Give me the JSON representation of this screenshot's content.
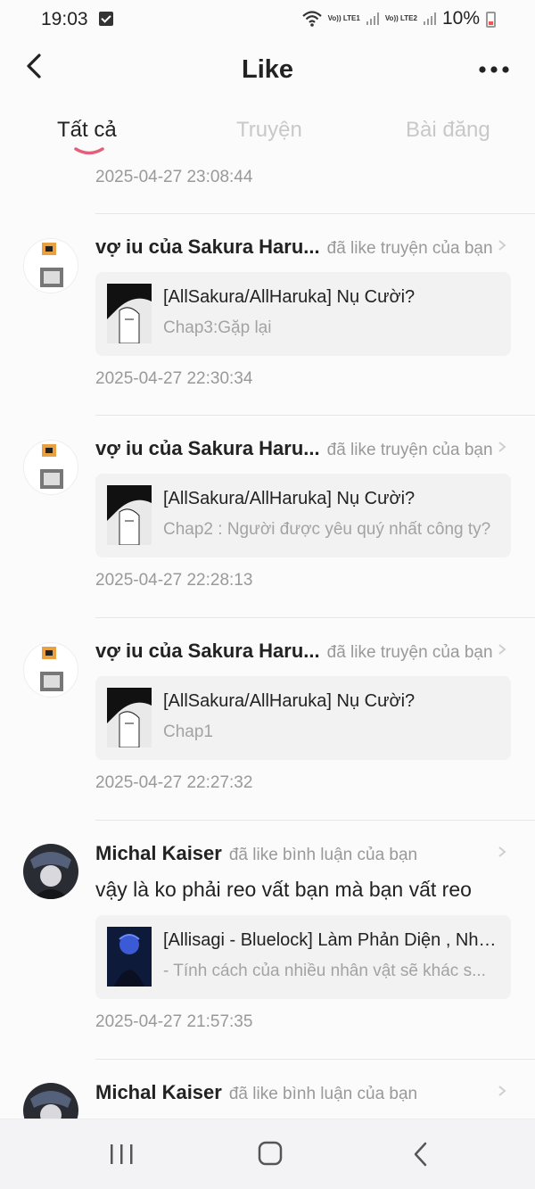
{
  "status": {
    "time": "19:03",
    "sim1": "Vo)) LTE1",
    "sim2": "Vo)) LTE2",
    "battery": "10%"
  },
  "header": {
    "title": "Like",
    "back_icon": "back-arrow-icon",
    "more_icon": "more-dots-icon"
  },
  "tabs": [
    {
      "label": "Tất cả",
      "active": true
    },
    {
      "label": "Truyện",
      "active": false
    },
    {
      "label": "Bài đăng",
      "active": false
    }
  ],
  "feed": {
    "top_timestamp": "2025-04-27 23:08:44",
    "items": [
      {
        "user": "vợ iu của Sakura Haru...",
        "action": "đã like truyện của bạn",
        "card_title": "[AllSakura/AllHaruka] Nụ Cười?",
        "card_sub": "Chap3:Gặp lại",
        "timestamp": "2025-04-27 22:30:34"
      },
      {
        "user": "vợ iu của Sakura Haru...",
        "action": "đã like truyện của bạn",
        "card_title": "[AllSakura/AllHaruka] Nụ Cười?",
        "card_sub": "Chap2 : Người được yêu quý nhất công ty?",
        "timestamp": "2025-04-27 22:28:13"
      },
      {
        "user": "vợ iu của Sakura Haru...",
        "action": "đã like truyện của bạn",
        "card_title": "[AllSakura/AllHaruka] Nụ Cười?",
        "card_sub": "Chap1",
        "timestamp": "2025-04-27 22:27:32"
      },
      {
        "user": "Michal Kaiser",
        "action": "đã like bình luận của bạn",
        "comment": "vậy là ko phải reo vất bạn mà bạn vất reo",
        "card_title": "[Allisagi - Bluelock] Làm Phản Diện , Nhưng...",
        "card_sub": "- Tính cách của nhiều nhân vật sẽ khác s...",
        "timestamp": "2025-04-27 21:57:35"
      },
      {
        "user": "Michal Kaiser",
        "action": "đã like bình luận của bạn"
      }
    ]
  },
  "nav": {
    "recent_icon": "recent-apps-icon",
    "home_icon": "home-icon",
    "back_icon": "system-back-icon"
  },
  "colors": {
    "accent": "#e2607a",
    "muted_text": "#999999",
    "card_bg": "#f2f2f2"
  }
}
